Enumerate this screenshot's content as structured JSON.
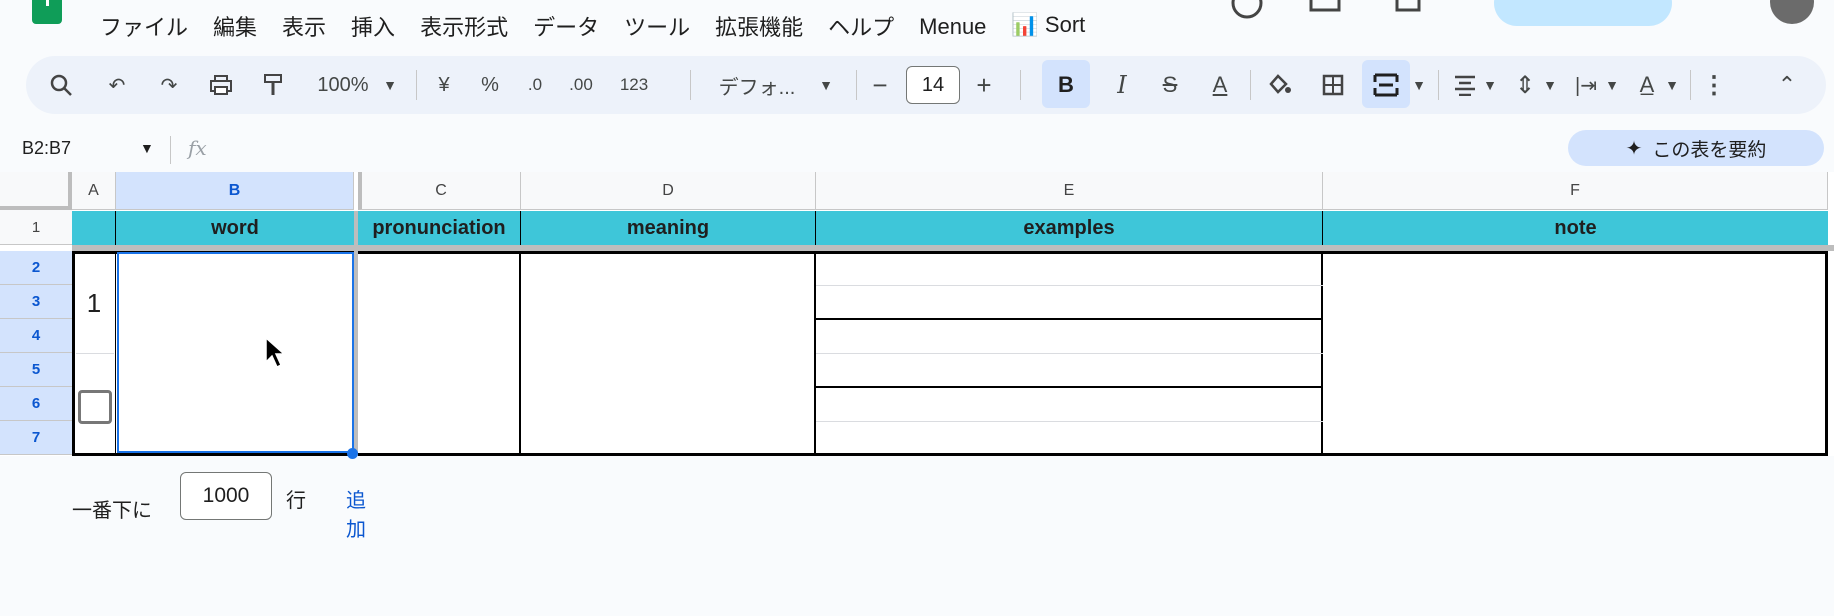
{
  "menu": [
    "ファイル",
    "編集",
    "表示",
    "挿入",
    "表示形式",
    "データ",
    "ツール",
    "拡張機能",
    "ヘルプ",
    "Menue",
    "📊 Sort"
  ],
  "toolbar": {
    "zoom": "100%",
    "currency": "¥",
    "percent": "%",
    "dec_less": ".0",
    "dec_more": ".00",
    "number_format": "123",
    "font": "デフォ...",
    "font_size": "14",
    "bold": "B",
    "italic": "I",
    "strike": "S",
    "text_color": "A"
  },
  "formula": {
    "name_box": "B2:B7",
    "fx": "fx",
    "summarize": "この表を要約"
  },
  "columns": [
    "A",
    "B",
    "C",
    "D",
    "E",
    "F"
  ],
  "rows": [
    "1",
    "2",
    "3",
    "4",
    "5",
    "6",
    "7"
  ],
  "header_row": {
    "b": "word",
    "c": "pronunciation",
    "d": "meaning",
    "e": "examples",
    "f": "note"
  },
  "cell_a": "1",
  "add_rows": {
    "label": "一番下に",
    "count": "1000",
    "unit": "行",
    "button": "追加"
  },
  "colors": {
    "header_bg": "#3ec6d9",
    "selection": "#1a73e8"
  }
}
